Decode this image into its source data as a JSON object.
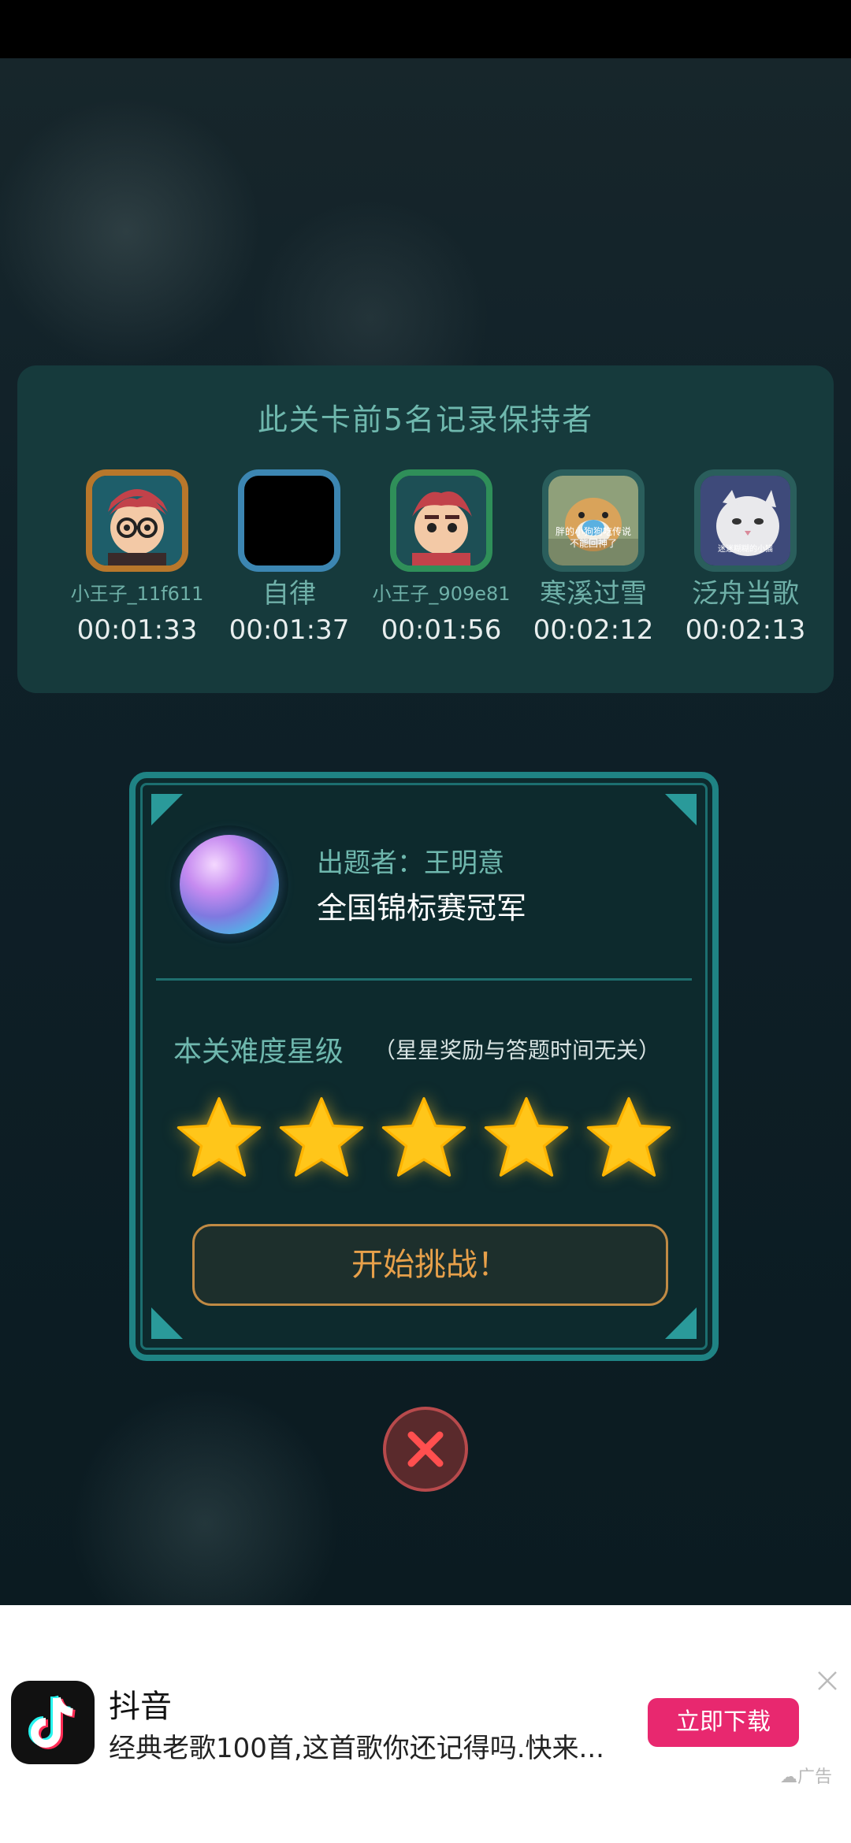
{
  "leaderboard": {
    "title": "此关卡前5名记录保持者",
    "players": [
      {
        "name": "小王子_11f611",
        "time": "00:01:33"
      },
      {
        "name": "自律",
        "time": "00:01:37"
      },
      {
        "name": "小王子_909e81",
        "time": "00:01:56"
      },
      {
        "name": "寒溪过雪",
        "time": "00:02:12"
      },
      {
        "name": "泛舟当歌",
        "time": "00:02:13"
      }
    ],
    "avatar_overlay_texts": [
      "胖的小狗狗吃传说",
      "不能回神了",
      "迷迷糊糊的小猫"
    ]
  },
  "challenge": {
    "author_label": "出题者：王明意",
    "author_title": "全国锦标赛冠军",
    "difficulty_label": "本关难度星级",
    "difficulty_note": "（星星奖励与答题时间无关）",
    "stars": 5,
    "stars_max": 5,
    "start_button": "开始挑战！"
  },
  "close_button": {
    "icon": "close-icon"
  },
  "ad": {
    "app_name": "抖音",
    "description": "经典老歌100首,这首歌你还记得吗.快来...",
    "button_label": "立即下载",
    "tag": "广告"
  },
  "colors": {
    "accent_teal": "#1f8384",
    "title_teal": "#6fb8ae",
    "gold": "#ffc61a",
    "ad_button": "#e8286f"
  }
}
